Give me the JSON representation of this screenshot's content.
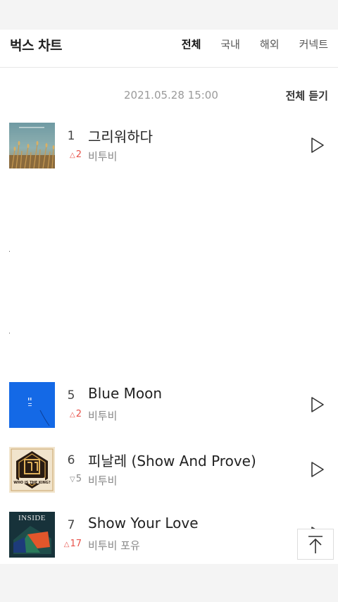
{
  "header": {
    "title": "벅스 차트",
    "tabs": [
      {
        "label": "전체",
        "active": true
      },
      {
        "label": "국내",
        "active": false
      },
      {
        "label": "해외",
        "active": false
      },
      {
        "label": "커넥트",
        "active": false
      }
    ]
  },
  "chart_info": {
    "timestamp": "2021.05.28 15:00",
    "play_all_label": "전체 듣기"
  },
  "songs": [
    {
      "rank": "1",
      "title": "그리워하다",
      "change_dir": "up",
      "change_arrow": "△",
      "change": "2",
      "artist": "비투비"
    },
    {
      "rank": "5",
      "title": "Blue Moon",
      "change_dir": "up",
      "change_arrow": "△",
      "change": "2",
      "artist": "비투비"
    },
    {
      "rank": "6",
      "title": "피날레 (Show And Prove)",
      "change_dir": "down",
      "change_arrow": "▽",
      "change": "5",
      "artist": "비투비"
    },
    {
      "rank": "7",
      "title": "Show Your Love",
      "change_dir": "up",
      "change_arrow": "△",
      "change": "17",
      "artist": "비투비 포유"
    }
  ],
  "album_art_text": {
    "inside_title": "INSIDE",
    "finale_badge": "WHO IS THE KING?"
  },
  "colors": {
    "up": "#e8524a",
    "down": "#888888",
    "accent_blue": "#1469e6"
  },
  "icons": {
    "play": "play-triangle-outline",
    "scroll_top": "arrow-up-to-bar"
  }
}
